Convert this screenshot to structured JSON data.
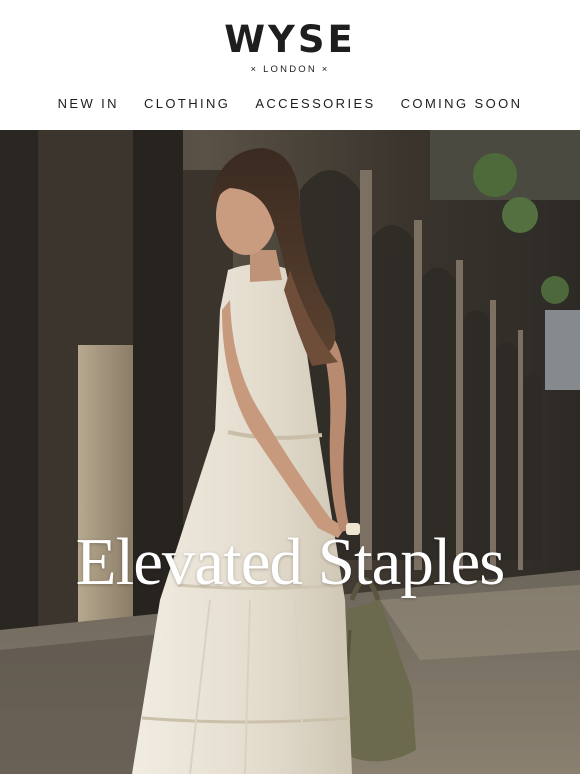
{
  "brand": {
    "name": "WYSE",
    "subline": "× LONDON ×"
  },
  "nav": {
    "items": [
      {
        "label": "NEW IN"
      },
      {
        "label": "CLOTHING"
      },
      {
        "label": "ACCESSORIES"
      },
      {
        "label": "COMING SOON"
      }
    ]
  },
  "hero": {
    "title": "Elevated Staples",
    "title_color": "#ffffff"
  },
  "colors": {
    "text": "#1e1e1e",
    "background": "#ffffff",
    "dress": "#e9e3d6"
  }
}
